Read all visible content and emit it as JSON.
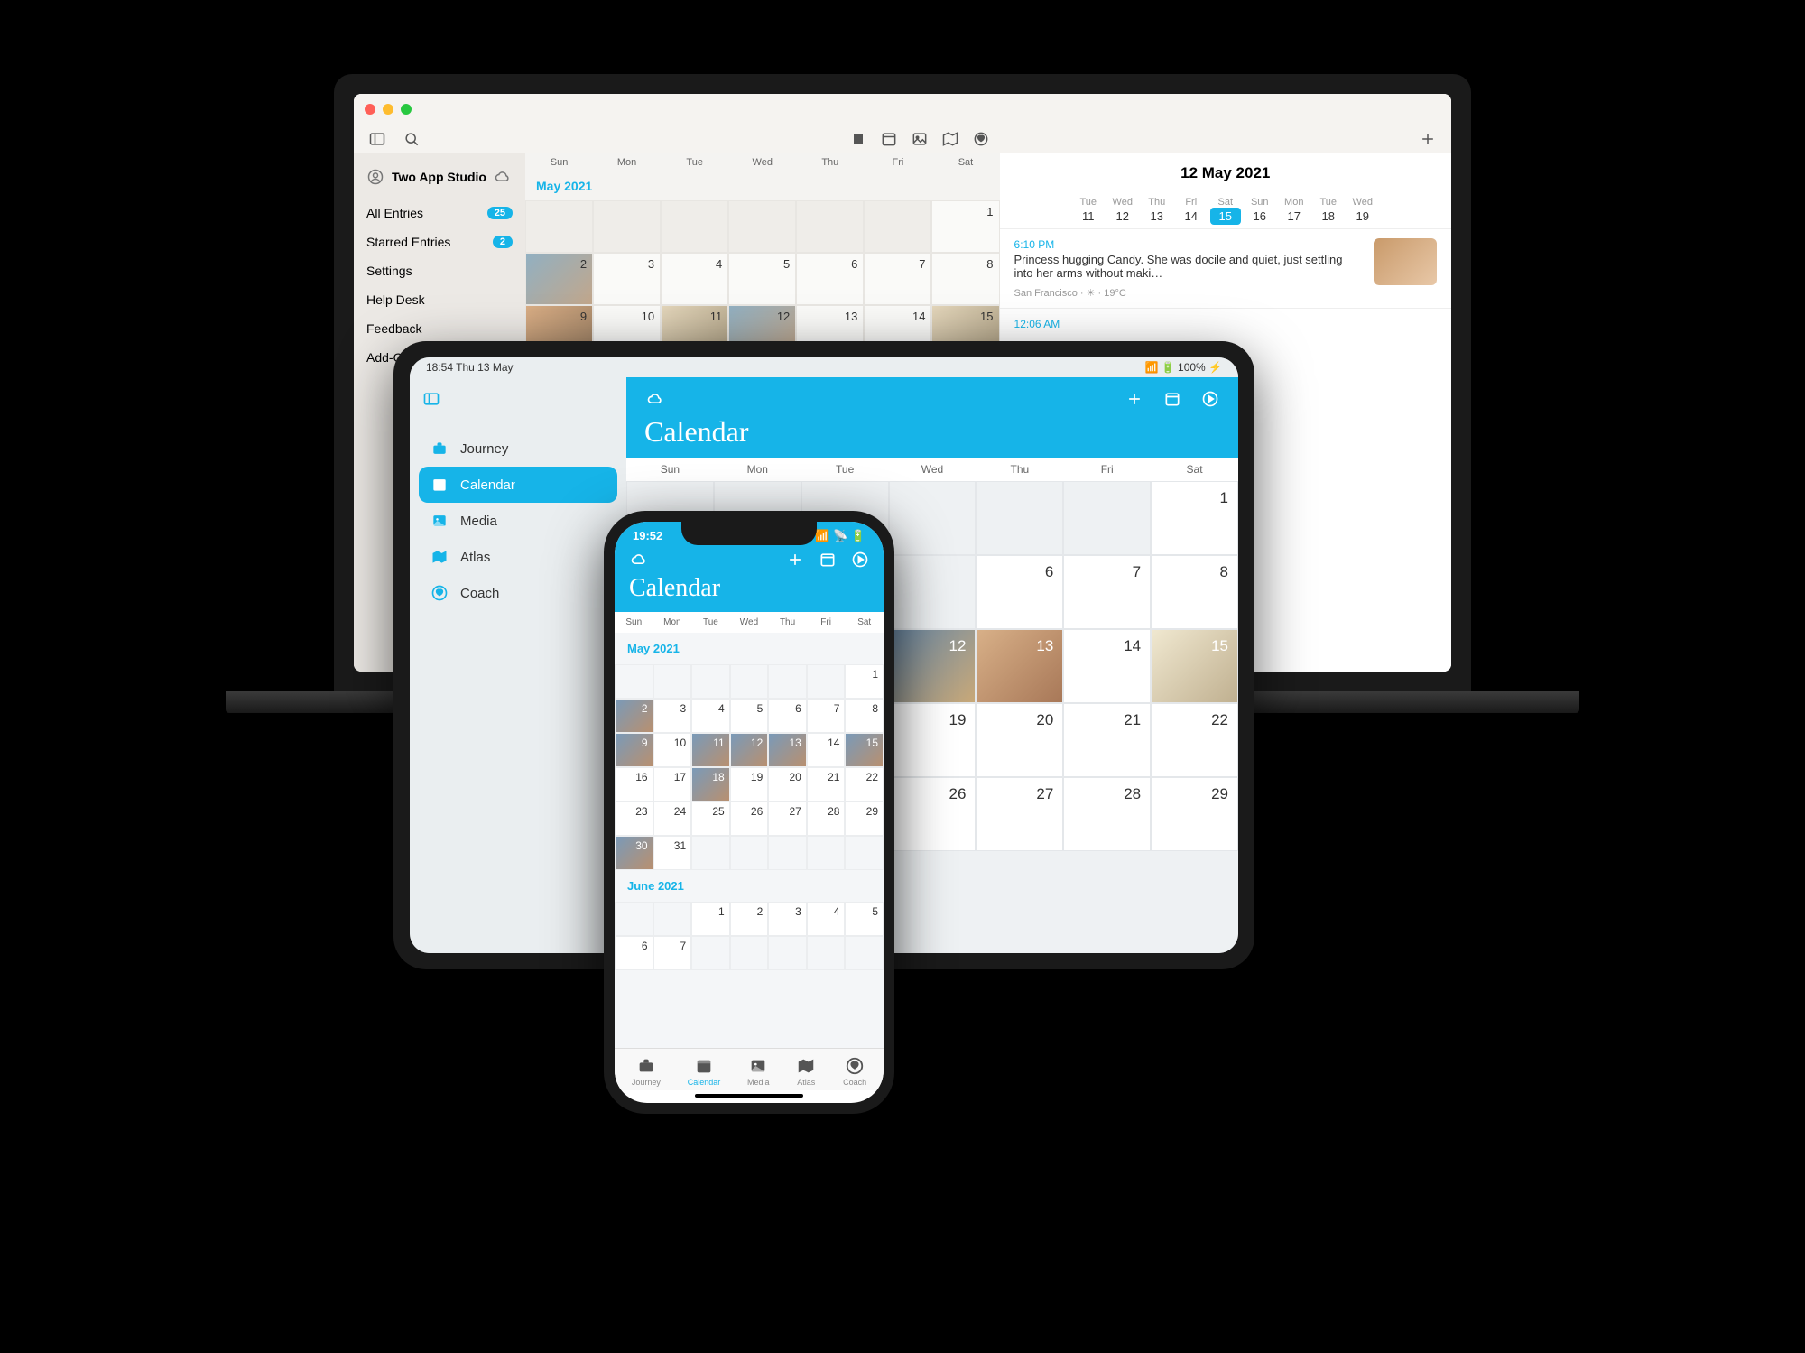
{
  "colors": {
    "accent": "#16b4e8"
  },
  "weekdays_short": [
    "Sun",
    "Mon",
    "Tue",
    "Wed",
    "Thu",
    "Fri",
    "Sat"
  ],
  "macbook": {
    "sidebar": {
      "user": "Two App Studio",
      "items": [
        {
          "label": "All Entries",
          "badge": "25"
        },
        {
          "label": "Starred Entries",
          "badge": "2"
        },
        {
          "label": "Settings"
        },
        {
          "label": "Help Desk"
        },
        {
          "label": "Feedback"
        },
        {
          "label": "Add-Ons"
        }
      ]
    },
    "calendar": {
      "month_label": "May 2021",
      "cells": [
        {
          "blank": true
        },
        {
          "blank": true
        },
        {
          "blank": true
        },
        {
          "blank": true
        },
        {
          "blank": true
        },
        {
          "blank": true
        },
        {
          "n": "1"
        },
        {
          "n": "2",
          "thm": 1
        },
        {
          "n": "3"
        },
        {
          "n": "4"
        },
        {
          "n": "5"
        },
        {
          "n": "6"
        },
        {
          "n": "7"
        },
        {
          "n": "8"
        },
        {
          "n": "9",
          "thm": 2
        },
        {
          "n": "10"
        },
        {
          "n": "11",
          "thm": 3
        },
        {
          "n": "12",
          "thm": 1
        },
        {
          "n": "13"
        },
        {
          "n": "14"
        },
        {
          "n": "15",
          "thm": 3
        }
      ]
    },
    "detail": {
      "title": "12 May 2021",
      "daystrip": [
        {
          "dow": "Tue",
          "num": "11"
        },
        {
          "dow": "Wed",
          "num": "12"
        },
        {
          "dow": "Thu",
          "num": "13"
        },
        {
          "dow": "Fri",
          "num": "14"
        },
        {
          "dow": "Sat",
          "num": "15",
          "sel": true
        },
        {
          "dow": "Sun",
          "num": "16"
        },
        {
          "dow": "Mon",
          "num": "17"
        },
        {
          "dow": "Tue",
          "num": "18"
        },
        {
          "dow": "Wed",
          "num": "19"
        }
      ],
      "entry": {
        "time": "6:10 PM",
        "body": "Princess hugging Candy. She was docile and quiet, just settling into her arms without maki…",
        "meta": "San Francisco · ☀ · 19°C"
      },
      "entry2_time": "12:06 AM"
    }
  },
  "ipad": {
    "status_left": "18:54   Thu 13 May",
    "status_right": "100%",
    "sidebar": [
      {
        "icon": "briefcase",
        "label": "Journey"
      },
      {
        "icon": "calendar",
        "label": "Calendar",
        "active": true
      },
      {
        "icon": "media",
        "label": "Media"
      },
      {
        "icon": "map",
        "label": "Atlas"
      },
      {
        "icon": "heart",
        "label": "Coach"
      }
    ],
    "header_title": "Calendar",
    "calendar_cells": [
      {
        "blank": true
      },
      {
        "blank": true
      },
      {
        "blank": true
      },
      {
        "blank": true
      },
      {
        "blank": true
      },
      {
        "blank": true
      },
      {
        "n": "1"
      },
      {
        "blank": true
      },
      {
        "blank": true
      },
      {
        "blank": true
      },
      {
        "blank": true
      },
      {
        "n": "6"
      },
      {
        "n": "7"
      },
      {
        "n": "8"
      },
      {
        "blank": true
      },
      {
        "blank": true
      },
      {
        "blank": true
      },
      {
        "n": "12",
        "thm": 1
      },
      {
        "n": "13",
        "thm": 2
      },
      {
        "n": "14"
      },
      {
        "n": "15",
        "thm": 3
      },
      {
        "blank": true
      },
      {
        "blank": true
      },
      {
        "blank": true
      },
      {
        "n": "19"
      },
      {
        "n": "20"
      },
      {
        "n": "21"
      },
      {
        "n": "22"
      },
      {
        "blank": true
      },
      {
        "blank": true
      },
      {
        "blank": true
      },
      {
        "n": "26"
      },
      {
        "n": "27"
      },
      {
        "n": "28"
      },
      {
        "n": "29"
      }
    ]
  },
  "iphone": {
    "status_time": "19:52",
    "header_title": "Calendar",
    "month1_label": "May 2021",
    "month1_cells": [
      {
        "blank": true
      },
      {
        "blank": true
      },
      {
        "blank": true
      },
      {
        "blank": true
      },
      {
        "blank": true
      },
      {
        "blank": true
      },
      {
        "n": "1"
      },
      {
        "n": "2",
        "thm": 1
      },
      {
        "n": "3"
      },
      {
        "n": "4"
      },
      {
        "n": "5"
      },
      {
        "n": "6"
      },
      {
        "n": "7"
      },
      {
        "n": "8"
      },
      {
        "n": "9",
        "thm": 1
      },
      {
        "n": "10"
      },
      {
        "n": "11",
        "thm": 1
      },
      {
        "n": "12",
        "thm": 1
      },
      {
        "n": "13",
        "thm": 1
      },
      {
        "n": "14"
      },
      {
        "n": "15",
        "thm": 1
      },
      {
        "n": "16"
      },
      {
        "n": "17"
      },
      {
        "n": "18",
        "thm": 1
      },
      {
        "n": "19"
      },
      {
        "n": "20"
      },
      {
        "n": "21"
      },
      {
        "n": "22"
      },
      {
        "n": "23"
      },
      {
        "n": "24"
      },
      {
        "n": "25"
      },
      {
        "n": "26"
      },
      {
        "n": "27"
      },
      {
        "n": "28"
      },
      {
        "n": "29"
      },
      {
        "n": "30",
        "thm": 1
      },
      {
        "n": "31"
      },
      {
        "blank": true
      },
      {
        "blank": true
      },
      {
        "blank": true
      },
      {
        "blank": true
      },
      {
        "blank": true
      }
    ],
    "month2_label": "June 2021",
    "month2_cells": [
      {
        "blank": true
      },
      {
        "blank": true
      },
      {
        "n": "1"
      },
      {
        "n": "2"
      },
      {
        "n": "3"
      },
      {
        "n": "4"
      },
      {
        "n": "5"
      },
      {
        "n": "6"
      },
      {
        "n": "7"
      },
      {
        "blank": true
      },
      {
        "blank": true
      },
      {
        "blank": true
      },
      {
        "blank": true
      },
      {
        "blank": true
      }
    ],
    "tabs": [
      {
        "icon": "briefcase",
        "label": "Journey"
      },
      {
        "icon": "calendar",
        "label": "Calendar",
        "active": true
      },
      {
        "icon": "media",
        "label": "Media"
      },
      {
        "icon": "map",
        "label": "Atlas"
      },
      {
        "icon": "heart",
        "label": "Coach"
      }
    ]
  }
}
